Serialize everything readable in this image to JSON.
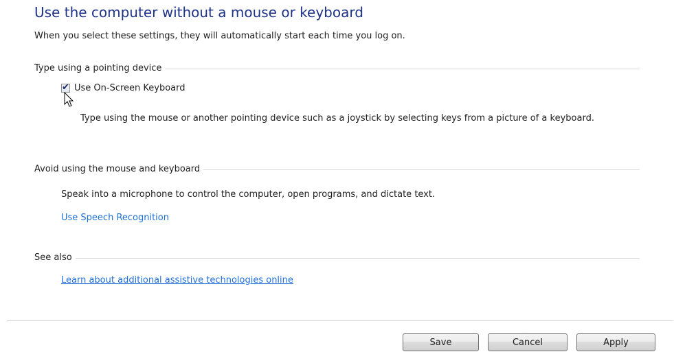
{
  "header": {
    "title": "Use the computer without a mouse or keyboard",
    "subtitle": "When you select these settings, they will automatically start each time you log on."
  },
  "sections": {
    "pointing": {
      "header": "Type using a pointing device",
      "checkbox_label": "Use On-Screen Keyboard",
      "checkbox_checked": true,
      "description": "Type using the mouse or another pointing device such as a joystick by selecting keys from a picture of a keyboard."
    },
    "avoid": {
      "header": "Avoid using the mouse and keyboard",
      "description": "Speak into a microphone to control the computer, open programs, and dictate text.",
      "link": "Use Speech Recognition"
    },
    "see_also": {
      "header": "See also",
      "link": "Learn about additional assistive technologies online"
    }
  },
  "buttons": {
    "save": "Save",
    "cancel": "Cancel",
    "apply": "Apply"
  },
  "icons": {
    "check": "check-icon",
    "cursor": "mouse-pointer-icon"
  }
}
